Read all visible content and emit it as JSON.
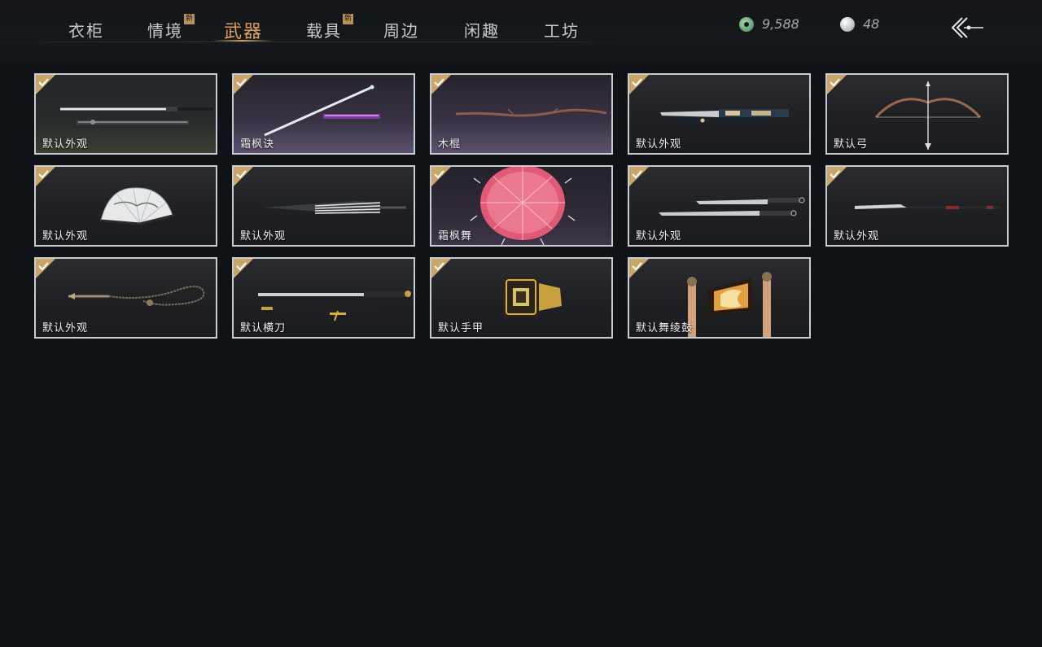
{
  "nav": {
    "tabs": [
      {
        "label": "衣柜",
        "badge": ""
      },
      {
        "label": "情境",
        "badge": "新"
      },
      {
        "label": "武器",
        "badge": ""
      },
      {
        "label": "载具",
        "badge": "新"
      },
      {
        "label": "周边",
        "badge": ""
      },
      {
        "label": "闲趣",
        "badge": ""
      },
      {
        "label": "工坊",
        "badge": ""
      }
    ],
    "active_tab": "武器"
  },
  "currency": {
    "jade_amount": "9,588",
    "pearl_amount": "48"
  },
  "items": [
    {
      "label": "默认外观",
      "icon": "twin-swords-icon",
      "owned": true
    },
    {
      "label": "霜枫诀",
      "icon": "jian-sword-icon",
      "owned": true
    },
    {
      "label": "木棍",
      "icon": "wooden-staff-icon",
      "owned": true
    },
    {
      "label": "默认外观",
      "icon": "ornate-blade-icon",
      "owned": true
    },
    {
      "label": "默认弓",
      "icon": "bow-icon",
      "owned": true
    },
    {
      "label": "默认外观",
      "icon": "folding-fan-icon",
      "owned": true
    },
    {
      "label": "默认外观",
      "icon": "closed-umbrella-icon",
      "owned": true
    },
    {
      "label": "霜枫舞",
      "icon": "red-umbrella-icon",
      "owned": true
    },
    {
      "label": "默认外观",
      "icon": "dual-sabers-icon",
      "owned": true
    },
    {
      "label": "默认外观",
      "icon": "spear-icon",
      "owned": true
    },
    {
      "label": "默认外观",
      "icon": "rope-dart-icon",
      "owned": true
    },
    {
      "label": "默认横刀",
      "icon": "hengdao-icon",
      "owned": true
    },
    {
      "label": "默认手甲",
      "icon": "gauntlet-icon",
      "owned": true
    },
    {
      "label": "默认舞绫鼓",
      "icon": "dance-drum-icon",
      "owned": true
    }
  ],
  "colors": {
    "background": "#0f1217",
    "accent": "#d9a05a",
    "card_border": "#c9ccd1",
    "check_gold": "#c9a56a"
  }
}
